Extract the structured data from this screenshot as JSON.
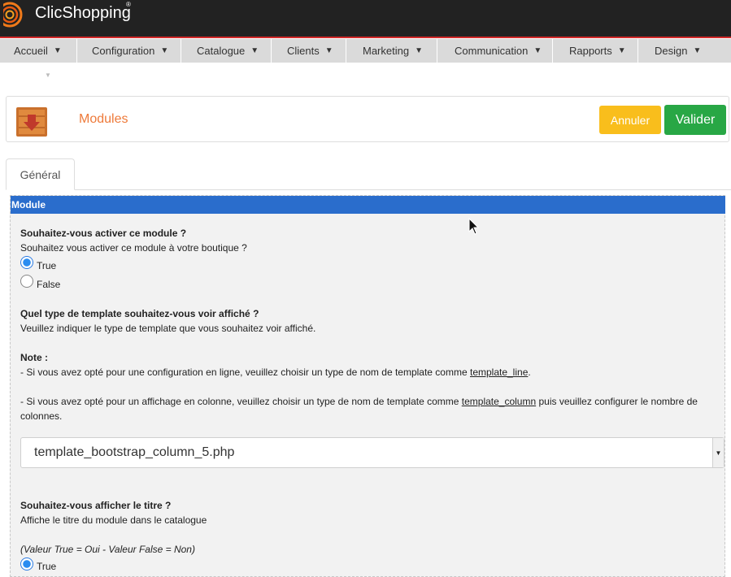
{
  "brand": {
    "name": "ClicShopping",
    "reg": "®"
  },
  "nav": [
    {
      "label": "Accueil"
    },
    {
      "label": "Configuration"
    },
    {
      "label": "Catalogue"
    },
    {
      "label": "Clients"
    },
    {
      "label": "Marketing"
    },
    {
      "label": "Communication"
    },
    {
      "label": "Rapports"
    },
    {
      "label": "Design"
    }
  ],
  "header": {
    "title": "Modules",
    "cancel_label": "Annuler",
    "submit_label": "Valider"
  },
  "tabs": [
    {
      "label": "Général"
    }
  ],
  "section": {
    "title": "Module",
    "q1": {
      "title": "Souhaitez-vous activer ce module ?",
      "desc": "Souhaitez vous activer ce module à votre boutique ?",
      "options": [
        "True",
        "False"
      ],
      "selected": "True"
    },
    "q2": {
      "title": "Quel type de template souhaitez-vous voir affiché ?",
      "desc": "Veuillez indiquer le type de template que vous souhaitez voir affiché.",
      "note_label": "Note :",
      "note1_pre": "- Si vous avez opté pour une configuration en ligne, veuillez choisir un type de nom de template comme ",
      "note1_link": "template_line",
      "note1_post": ".",
      "note2_pre": "- Si vous avez opté pour un affichage en colonne, veuillez choisir un type de nom de template comme ",
      "note2_link": "template_column",
      "note2_post": " puis veuillez configurer le nombre de",
      "note2_cont": "colonnes.",
      "select_value": "template_bootstrap_column_5.php"
    },
    "q3": {
      "title": "Souhaitez-vous afficher le titre ?",
      "desc": "Affiche le titre du module dans le catalogue",
      "hint": "(Valeur True = Oui - Valeur False = Non)",
      "options": [
        "True"
      ]
    }
  },
  "colors": {
    "brand_orange": "#ee7a3a",
    "topbar": "#222222",
    "accent_blue": "#2a6dcc",
    "cancel": "#f9be1c",
    "submit": "#28a745"
  }
}
